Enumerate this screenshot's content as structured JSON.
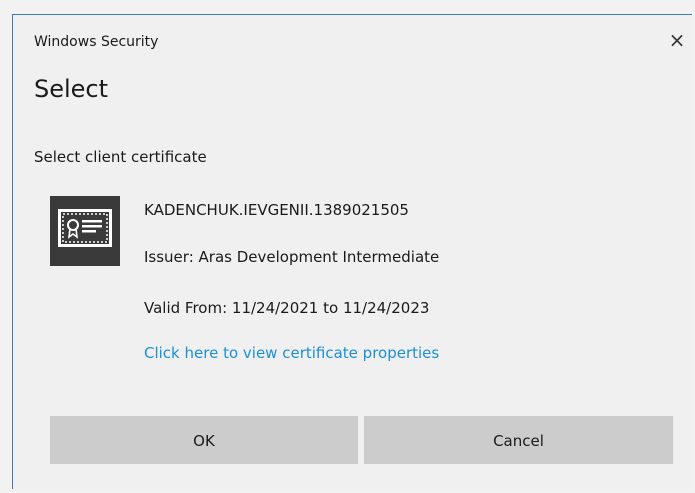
{
  "window": {
    "title": "Windows Security",
    "close_glyph": "×"
  },
  "dialog": {
    "heading": "Select",
    "subheading": "Select client certificate"
  },
  "certificate": {
    "icon": "certificate-icon",
    "name": "KADENCHUK.IEVGENII.1389021505",
    "issuer": "Issuer: Aras Development Intermediate",
    "valid": "Valid From: 11/24/2021 to 11/24/2023",
    "link": "Click here to view certificate properties"
  },
  "buttons": {
    "ok": "OK",
    "cancel": "Cancel"
  },
  "colors": {
    "link": "#1b8fd6",
    "button_bg": "#cccccc",
    "border_accent": "#3a79c7"
  }
}
